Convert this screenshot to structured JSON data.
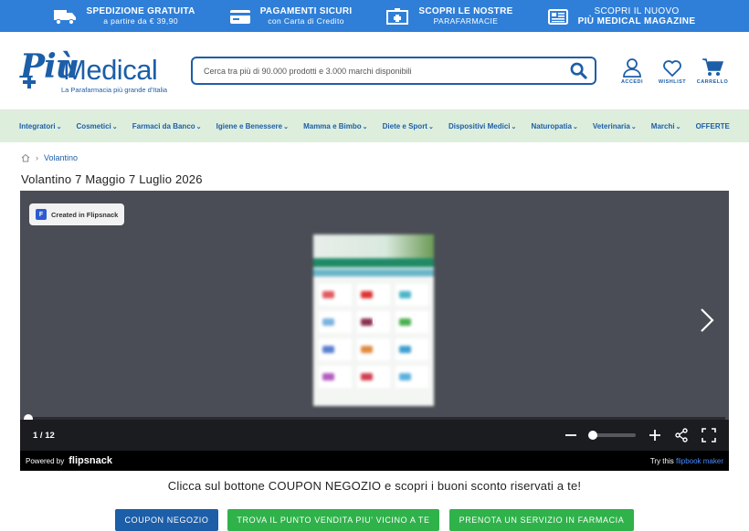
{
  "promo": [
    {
      "icon": "truck-icon",
      "title": "SPEDIZIONE GRATUITA",
      "sub": "a partire da € 39,90"
    },
    {
      "icon": "credit-card-icon",
      "title": "PAGAMENTI SICURI",
      "sub": "con Carta di Credito"
    },
    {
      "icon": "pharmacy-cross-icon",
      "title": "SCOPRI LE NOSTRE",
      "sub": "PARAFARMACIE"
    },
    {
      "icon": "magazine-icon",
      "title": "SCOPRI IL NUOVO",
      "sub": "PIÙ MEDICAL MAGAZINE"
    }
  ],
  "logo": {
    "piu": "Più",
    "medical": "Medical",
    "tagline": "La Parafarmacia più grande d'Italia"
  },
  "search": {
    "placeholder": "Cerca tra più di 90.000 prodotti e 3.000 marchi disponibili"
  },
  "header_icons": [
    {
      "icon": "user-icon",
      "label": "ACCEDI"
    },
    {
      "icon": "heart-icon",
      "label": "WISHLIST"
    },
    {
      "icon": "cart-icon",
      "label": "CARRELLO"
    }
  ],
  "nav": [
    {
      "label": "Integratori",
      "caret": true
    },
    {
      "label": "Cosmetici",
      "caret": true
    },
    {
      "label": "Farmaci da Banco",
      "caret": true
    },
    {
      "label": "Igiene e Benessere",
      "caret": true
    },
    {
      "label": "Mamma e Bimbo",
      "caret": true
    },
    {
      "label": "Diete e Sport",
      "caret": true
    },
    {
      "label": "Dispositivi Medici",
      "caret": true
    },
    {
      "label": "Naturopatia",
      "caret": true
    },
    {
      "label": "Veterinaria",
      "caret": true
    },
    {
      "label": "Marchi",
      "caret": true
    },
    {
      "label": "OFFERTE",
      "caret": false
    }
  ],
  "breadcrumb": {
    "current": "Volantino"
  },
  "page_title": "Volantino 7 Maggio 7 Luglio 2026",
  "flipbook": {
    "badge": "Created in Flipsnack",
    "page_counter": "1 / 12",
    "powered_by": "Powered by",
    "brand": "flipsnack",
    "try_text": "Try this ",
    "try_link": "flipbook maker",
    "progress": 0.0
  },
  "coupon_text": "Clicca sul bottone COUPON NEGOZIO e scopri i buoni sconto riservati a te!",
  "cta": {
    "coupon": "COUPON NEGOZIO",
    "store": "TROVA IL PUNTO VENDITA PIU' VICINO A TE",
    "service": "PRENOTA UN SERVIZIO IN FARMACIA"
  },
  "colors": {
    "primary": "#1c5ea8",
    "promo_bar": "#2f7fd8",
    "nav_bg": "#ddeedd",
    "cta_green": "#2fb24a",
    "player_bg": "#4a4d55"
  }
}
